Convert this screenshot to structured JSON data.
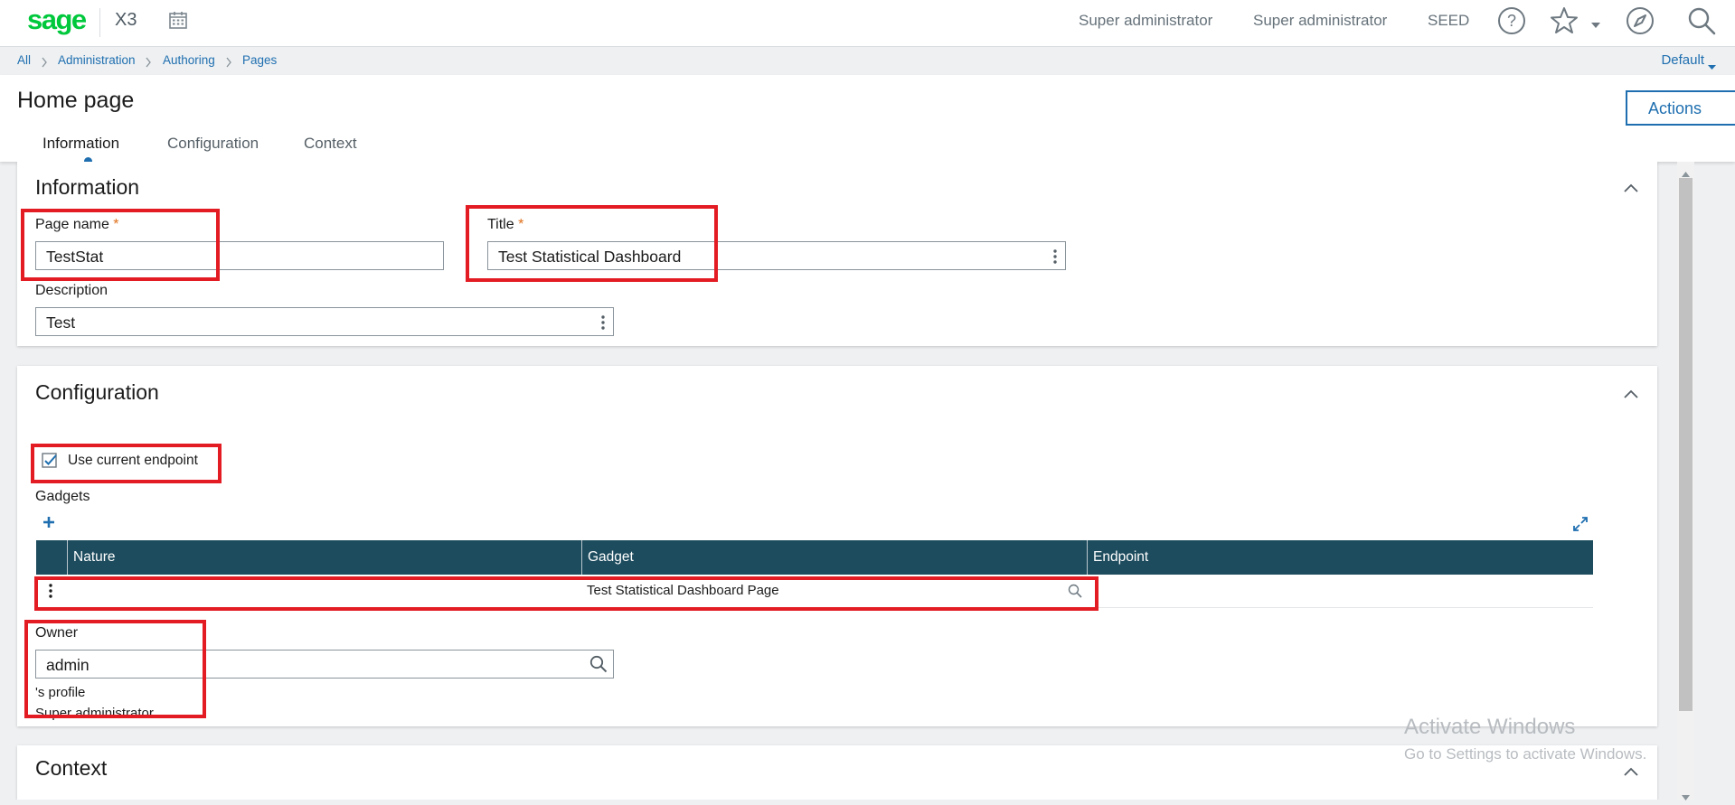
{
  "header": {
    "logo_text": "sage",
    "app_name": "X3",
    "user_items": [
      "Super administrator",
      "Super administrator",
      "SEED"
    ],
    "icons": [
      "calendar-icon",
      "help-icon",
      "star-icon",
      "compass-icon",
      "search-icon"
    ]
  },
  "breadcrumb": {
    "items": [
      "All",
      "Administration",
      "Authoring",
      "Pages"
    ],
    "right_selector": "Default"
  },
  "page": {
    "title": "Home page",
    "actions_label": "Actions",
    "tabs": [
      "Information",
      "Configuration",
      "Context"
    ],
    "active_tab": "Information"
  },
  "information": {
    "title": "Information",
    "page_name_label": "Page name",
    "page_name_value": "TestStat",
    "title_label": "Title",
    "title_value": "Test Statistical Dashboard",
    "description_label": "Description",
    "description_value": "Test",
    "required_marker": "*"
  },
  "configuration": {
    "title": "Configuration",
    "use_current_endpoint_label": "Use current endpoint",
    "use_current_endpoint_checked": true,
    "gadgets_label": "Gadgets",
    "columns": [
      "Nature",
      "Gadget",
      "Endpoint"
    ],
    "rows": [
      {
        "nature": "",
        "gadget": "Test Statistical Dashboard Page",
        "endpoint": ""
      }
    ],
    "owner_label": "Owner",
    "owner_value": "admin",
    "profile_label": "'s profile",
    "profile_value": "Super administrator"
  },
  "context": {
    "title": "Context"
  },
  "watermark": {
    "line1": "Activate Windows",
    "line2": "Go to Settings to activate Windows."
  },
  "colors": {
    "brand_green": "#00c83c",
    "link_blue": "#1f6fb0",
    "grid_header": "#1d4c5e",
    "highlight_red": "#e31b23",
    "required_orange": "#e0701b"
  }
}
